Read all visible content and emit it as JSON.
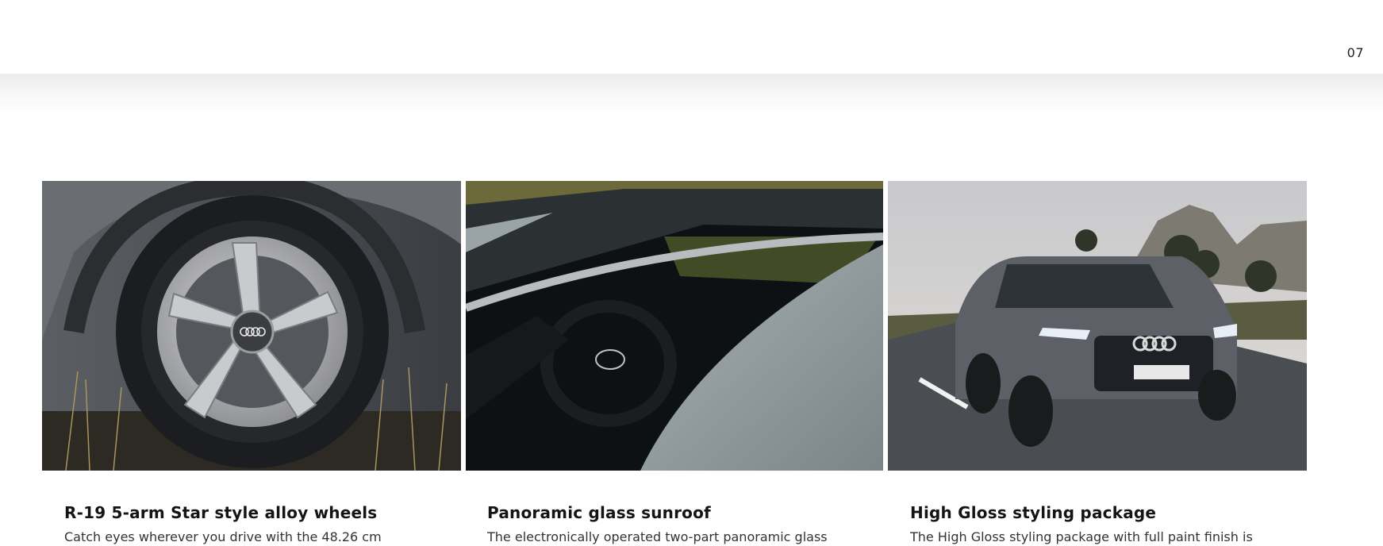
{
  "page": {
    "number": "07"
  },
  "features": [
    {
      "title": "R-19 5-arm Star style alloy wheels",
      "description": "Catch eyes wherever you drive with the 48.26 cm",
      "image": "alloy-wheel-photo"
    },
    {
      "title": "Panoramic glass sunroof",
      "description": "The electronically operated two-part panoramic glass",
      "image": "panoramic-sunroof-photo"
    },
    {
      "title": "High Gloss styling package",
      "description": "The High Gloss styling package with full paint finish is",
      "image": "audi-q7-front-photo"
    }
  ],
  "colors": {
    "background": "#ffffff",
    "text": "#1a1a1a",
    "shade": "#ececec"
  }
}
